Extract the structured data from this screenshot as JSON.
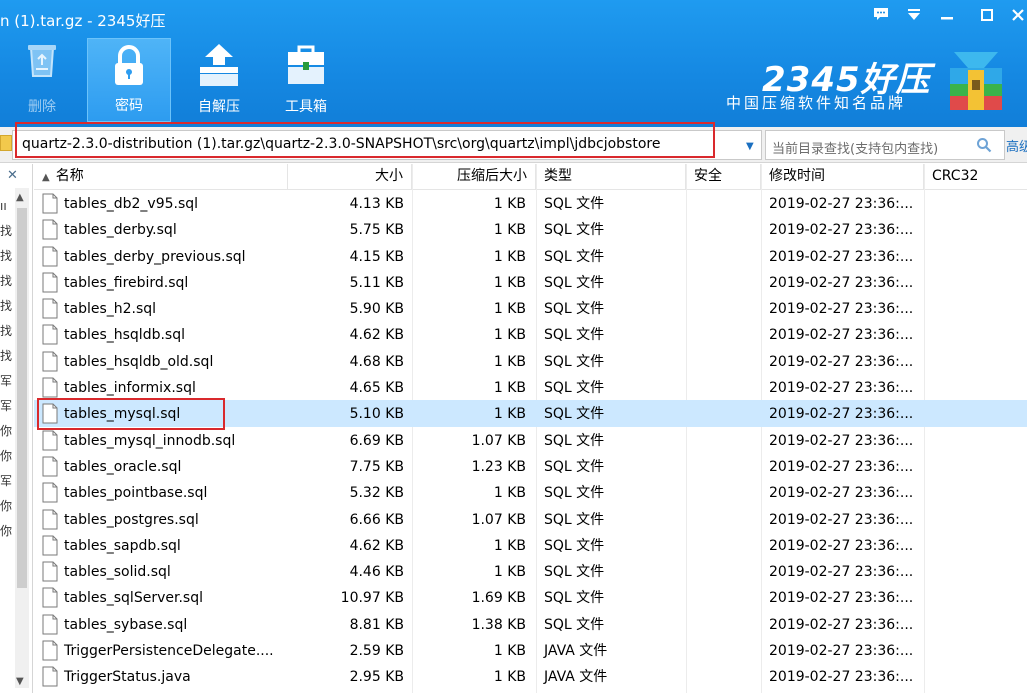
{
  "window": {
    "title": "n (1).tar.gz - 2345好压",
    "controls": [
      "feedback-icon",
      "dropdown-icon",
      "minimize-icon",
      "maximize-icon",
      "close-icon"
    ]
  },
  "toolbar": {
    "delete_label": "删除",
    "password_label": "密码",
    "sfx_label": "自解压",
    "toolbox_label": "工具箱"
  },
  "brand": {
    "name": "2345好压",
    "slogan": "中国压缩软件知名品牌",
    "accent_color": "#1588e2"
  },
  "address": {
    "path": "quartz-2.3.0-distribution (1).tar.gz\\quartz-2.3.0-SNAPSHOT\\src\\org\\quartz\\impl\\jdbcjobstore"
  },
  "search": {
    "placeholder": "当前目录查找(支持包内查找)",
    "advanced_label": "高级"
  },
  "tree": {
    "chars": [
      "ıı",
      "找",
      "找",
      "找",
      "找",
      "找",
      "找",
      "军",
      "军",
      "你",
      "你",
      "军",
      "你",
      "你"
    ]
  },
  "columns": {
    "name": "名称",
    "size": "大小",
    "compressed": "压缩后大小",
    "type": "类型",
    "security": "安全",
    "modified": "修改时间",
    "crc": "CRC32"
  },
  "files": [
    {
      "name": "tables_db2_v95.sql",
      "size": "4.13 KB",
      "csize": "1 KB",
      "type": "SQL 文件",
      "mtime": "2019-02-27 23:36:..."
    },
    {
      "name": "tables_derby.sql",
      "size": "5.75 KB",
      "csize": "1 KB",
      "type": "SQL 文件",
      "mtime": "2019-02-27 23:36:..."
    },
    {
      "name": "tables_derby_previous.sql",
      "size": "4.15 KB",
      "csize": "1 KB",
      "type": "SQL 文件",
      "mtime": "2019-02-27 23:36:..."
    },
    {
      "name": "tables_firebird.sql",
      "size": "5.11 KB",
      "csize": "1 KB",
      "type": "SQL 文件",
      "mtime": "2019-02-27 23:36:..."
    },
    {
      "name": "tables_h2.sql",
      "size": "5.90 KB",
      "csize": "1 KB",
      "type": "SQL 文件",
      "mtime": "2019-02-27 23:36:..."
    },
    {
      "name": "tables_hsqldb.sql",
      "size": "4.62 KB",
      "csize": "1 KB",
      "type": "SQL 文件",
      "mtime": "2019-02-27 23:36:..."
    },
    {
      "name": "tables_hsqldb_old.sql",
      "size": "4.68 KB",
      "csize": "1 KB",
      "type": "SQL 文件",
      "mtime": "2019-02-27 23:36:..."
    },
    {
      "name": "tables_informix.sql",
      "size": "4.65 KB",
      "csize": "1 KB",
      "type": "SQL 文件",
      "mtime": "2019-02-27 23:36:..."
    },
    {
      "name": "tables_mysql.sql",
      "size": "5.10 KB",
      "csize": "1 KB",
      "type": "SQL 文件",
      "mtime": "2019-02-27 23:36:...",
      "selected": true
    },
    {
      "name": "tables_mysql_innodb.sql",
      "size": "6.69 KB",
      "csize": "1.07 KB",
      "type": "SQL 文件",
      "mtime": "2019-02-27 23:36:..."
    },
    {
      "name": "tables_oracle.sql",
      "size": "7.75 KB",
      "csize": "1.23 KB",
      "type": "SQL 文件",
      "mtime": "2019-02-27 23:36:..."
    },
    {
      "name": "tables_pointbase.sql",
      "size": "5.32 KB",
      "csize": "1 KB",
      "type": "SQL 文件",
      "mtime": "2019-02-27 23:36:..."
    },
    {
      "name": "tables_postgres.sql",
      "size": "6.66 KB",
      "csize": "1.07 KB",
      "type": "SQL 文件",
      "mtime": "2019-02-27 23:36:..."
    },
    {
      "name": "tables_sapdb.sql",
      "size": "4.62 KB",
      "csize": "1 KB",
      "type": "SQL 文件",
      "mtime": "2019-02-27 23:36:..."
    },
    {
      "name": "tables_solid.sql",
      "size": "4.46 KB",
      "csize": "1 KB",
      "type": "SQL 文件",
      "mtime": "2019-02-27 23:36:..."
    },
    {
      "name": "tables_sqlServer.sql",
      "size": "10.97 KB",
      "csize": "1.69 KB",
      "type": "SQL 文件",
      "mtime": "2019-02-27 23:36:..."
    },
    {
      "name": "tables_sybase.sql",
      "size": "8.81 KB",
      "csize": "1.38 KB",
      "type": "SQL 文件",
      "mtime": "2019-02-27 23:36:..."
    },
    {
      "name": "TriggerPersistenceDelegate....",
      "size": "2.59 KB",
      "csize": "1 KB",
      "type": "JAVA 文件",
      "mtime": "2019-02-27 23:36:..."
    },
    {
      "name": "TriggerStatus.java",
      "size": "2.95 KB",
      "csize": "1 KB",
      "type": "JAVA 文件",
      "mtime": "2019-02-27 23:36:..."
    }
  ]
}
